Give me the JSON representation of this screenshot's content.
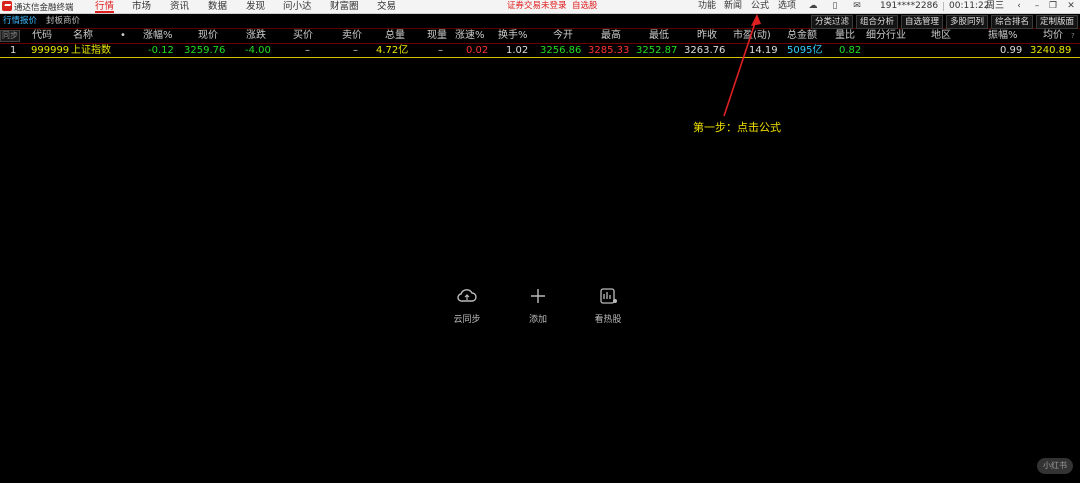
{
  "app": {
    "title": "通达信金融终端"
  },
  "menu": [
    "行情",
    "市场",
    "资讯",
    "数据",
    "发现",
    "问小达",
    "财富圈",
    "交易"
  ],
  "notice": {
    "login": "证券交易未登录",
    "watchlist": "自选股"
  },
  "right_menu": [
    "功能",
    "新闻",
    "公式",
    "选项"
  ],
  "account": "191****2286",
  "clock": "00:11:22",
  "weekday": "周三",
  "tabs": [
    "行情报价",
    "封板商价"
  ],
  "right_tabs": [
    "分类过滤",
    "组合分析",
    "自选管理",
    "多股同列",
    "综合排名",
    "定制版面"
  ],
  "columns": {
    "indicator": "同步",
    "code": "代码",
    "name": "名称",
    "dot": "•",
    "change_pct": "涨幅%",
    "price": "现价",
    "change": "涨跌",
    "bid": "买价",
    "ask": "卖价",
    "volume": "总量",
    "cur_vol": "现量",
    "speed": "涨速%",
    "turnover": "换手%",
    "open": "今开",
    "high": "最高",
    "low": "最低",
    "prev_close": "昨收",
    "pe": "市盈(动)",
    "amount": "总金额",
    "vol_ratio": "量比",
    "industry": "细分行业",
    "region": "地区",
    "amplitude": "振幅%",
    "avg": "均价",
    "help": "?"
  },
  "rows": [
    {
      "index": "1",
      "code": "999999",
      "name": "上证指数",
      "change_pct": "-0.12",
      "price": "3259.76",
      "change": "-4.00",
      "bid": "–",
      "ask": "–",
      "volume": "4.72亿",
      "cur_vol": "–",
      "speed": "0.02",
      "turnover": "1.02",
      "open": "3256.86",
      "high": "3285.33",
      "low": "3252.87",
      "prev_close": "3263.76",
      "pe": "14.19",
      "amount": "5095亿",
      "vol_ratio": "0.82",
      "amplitude": "0.99",
      "avg": "3240.89"
    }
  ],
  "annotation": "第一步：点击公式",
  "empty_tools": [
    {
      "label": "云同步",
      "icon": "cloud-sync-icon"
    },
    {
      "label": "添加",
      "icon": "plus-icon"
    },
    {
      "label": "看热股",
      "icon": "hot-stock-icon"
    }
  ],
  "watermark": "小红书",
  "colors": {
    "up": "#ff3333",
    "down": "#22dd22",
    "accent": "#e02020",
    "highlight": "#f0e000",
    "link": "#3fb8ff"
  }
}
